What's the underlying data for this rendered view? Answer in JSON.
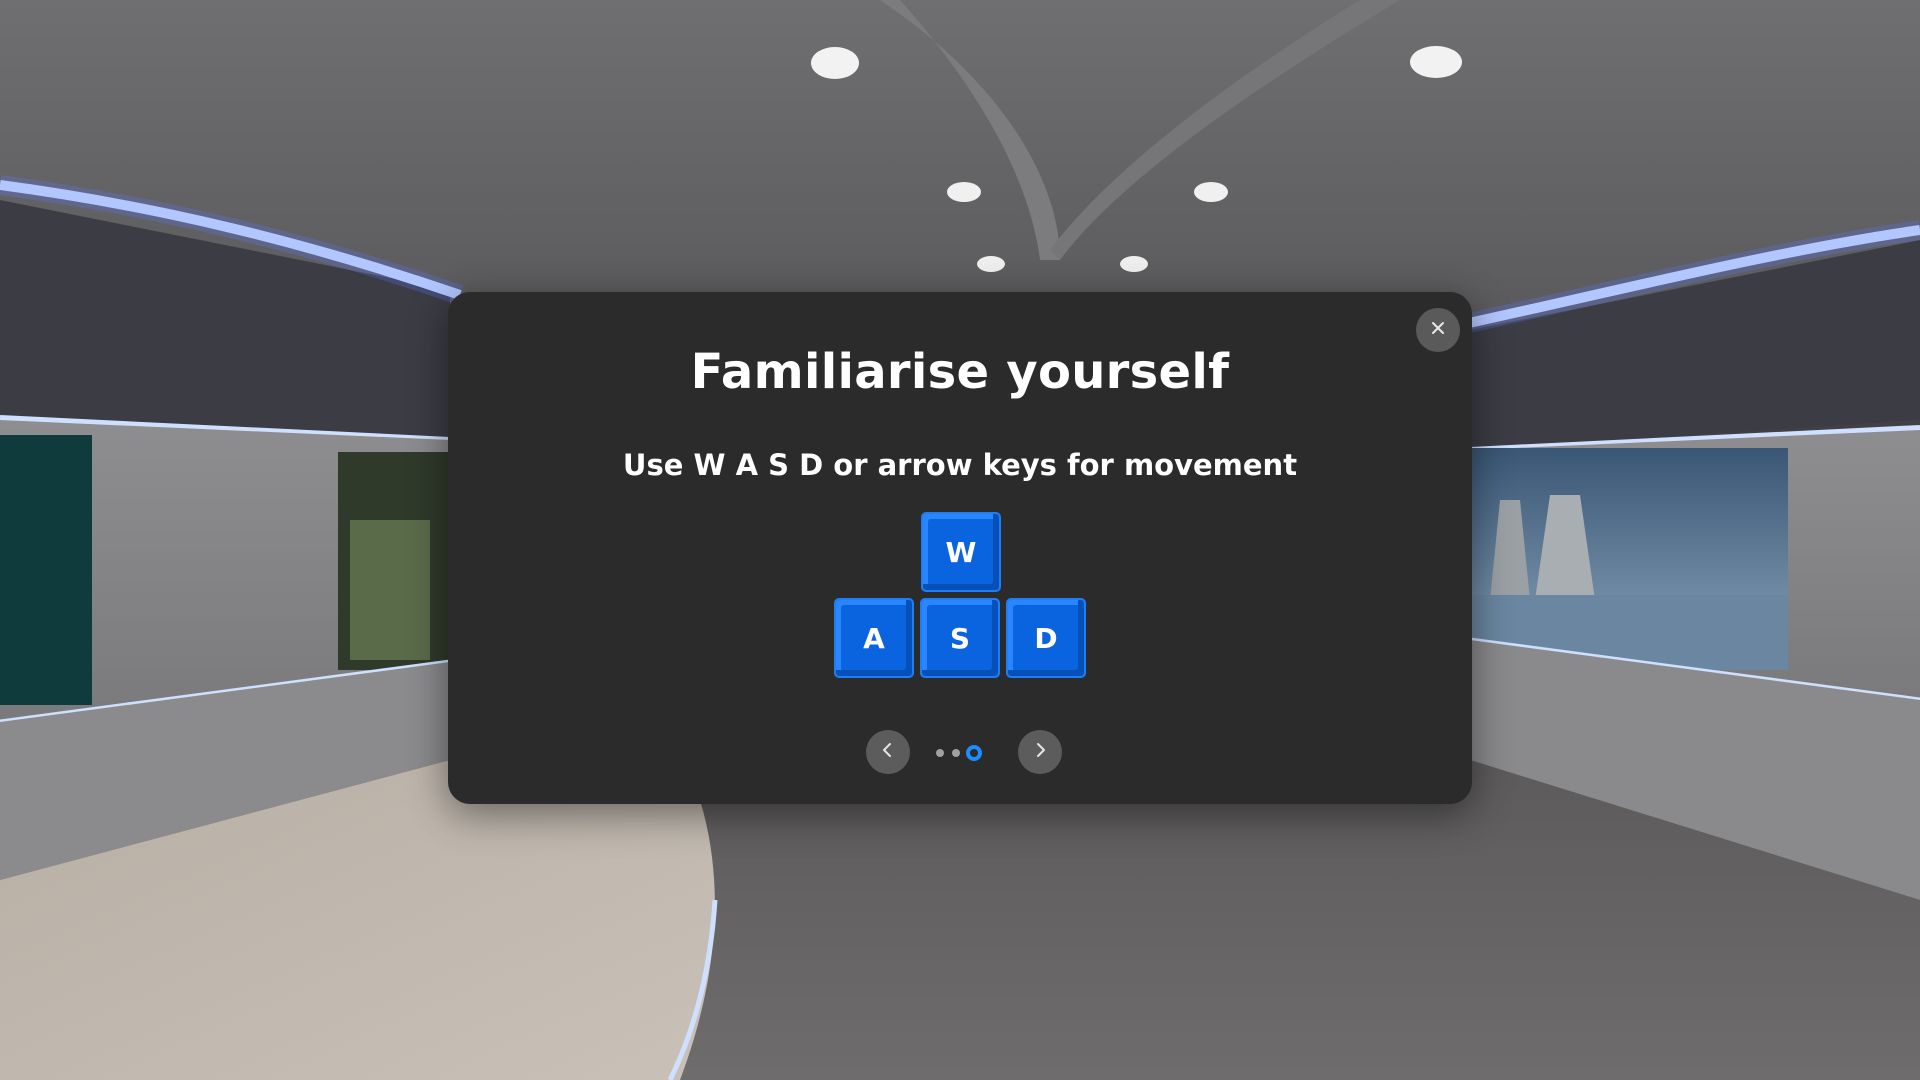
{
  "modal": {
    "title": "Familiarise yourself",
    "subtitle": "Use W A S D or arrow keys for movement",
    "keys": {
      "w": "W",
      "a": "A",
      "s": "S",
      "d": "D"
    },
    "pagination": {
      "total_pages": 3,
      "current_page": 3
    },
    "icons": {
      "close": "close-icon",
      "previous": "chevron-left-icon",
      "next": "chevron-right-icon"
    }
  },
  "colors": {
    "modal_background": "#2b2b2b",
    "key_blue": "#0a64e0",
    "active_dot": "#1c8cff",
    "ceiling_light_strip": "#cfe0ff"
  }
}
